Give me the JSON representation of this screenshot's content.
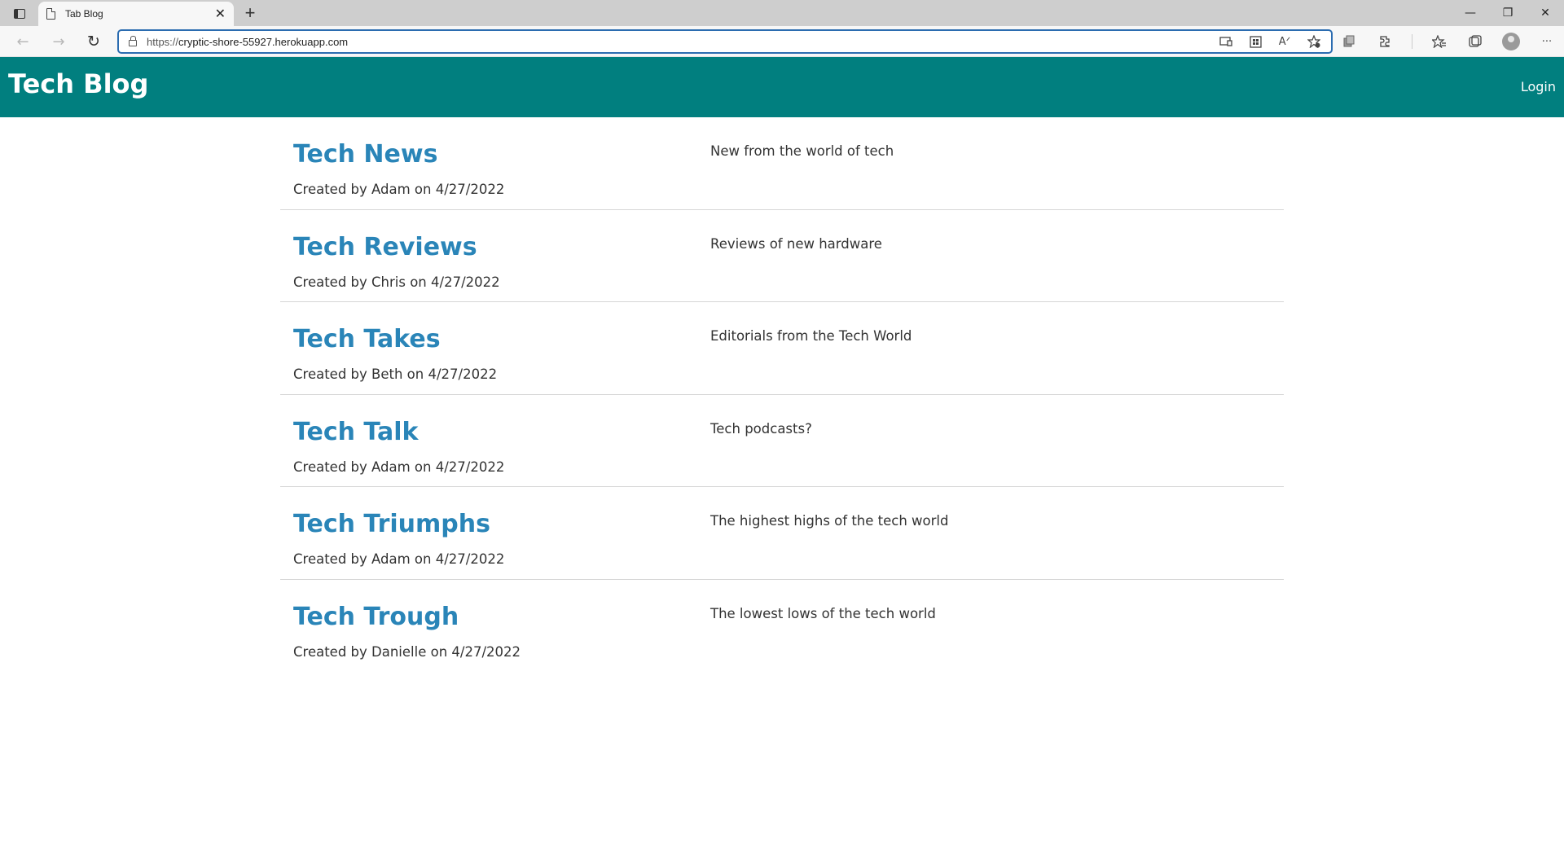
{
  "browser": {
    "tab_title": "Tab Blog",
    "tab_close": "✕",
    "new_tab": "+",
    "url_protocol": "https://",
    "url_host": "cryptic-shore-55927.herokuapp.com",
    "window_controls": {
      "minimize": "—",
      "restore": "❐",
      "close": "✕"
    },
    "nav": {
      "back": "←",
      "forward": "→",
      "refresh": "↻"
    },
    "icons": {
      "read_aloud": "Aᐟ",
      "more": "···"
    }
  },
  "header": {
    "title": "Tech Blog",
    "login_label": "Login",
    "background_color": "#017f7f"
  },
  "posts": [
    {
      "title": "Tech News",
      "meta": "Created by Adam on 4/27/2022",
      "description": "New from the world of tech"
    },
    {
      "title": "Tech Reviews",
      "meta": "Created by Chris on 4/27/2022",
      "description": "Reviews of new hardware"
    },
    {
      "title": "Tech Takes",
      "meta": "Created by Beth on 4/27/2022",
      "description": "Editorials from the Tech World"
    },
    {
      "title": "Tech Talk",
      "meta": "Created by Adam on 4/27/2022",
      "description": "Tech podcasts?"
    },
    {
      "title": "Tech Triumphs",
      "meta": "Created by Adam on 4/27/2022",
      "description": "The highest highs of the tech world"
    },
    {
      "title": "Tech Trough",
      "meta": "Created by Danielle on 4/27/2022",
      "description": "The lowest lows of the tech world"
    }
  ],
  "colors": {
    "post_title": "#2a85b8",
    "divider": "#d6d6d6"
  }
}
